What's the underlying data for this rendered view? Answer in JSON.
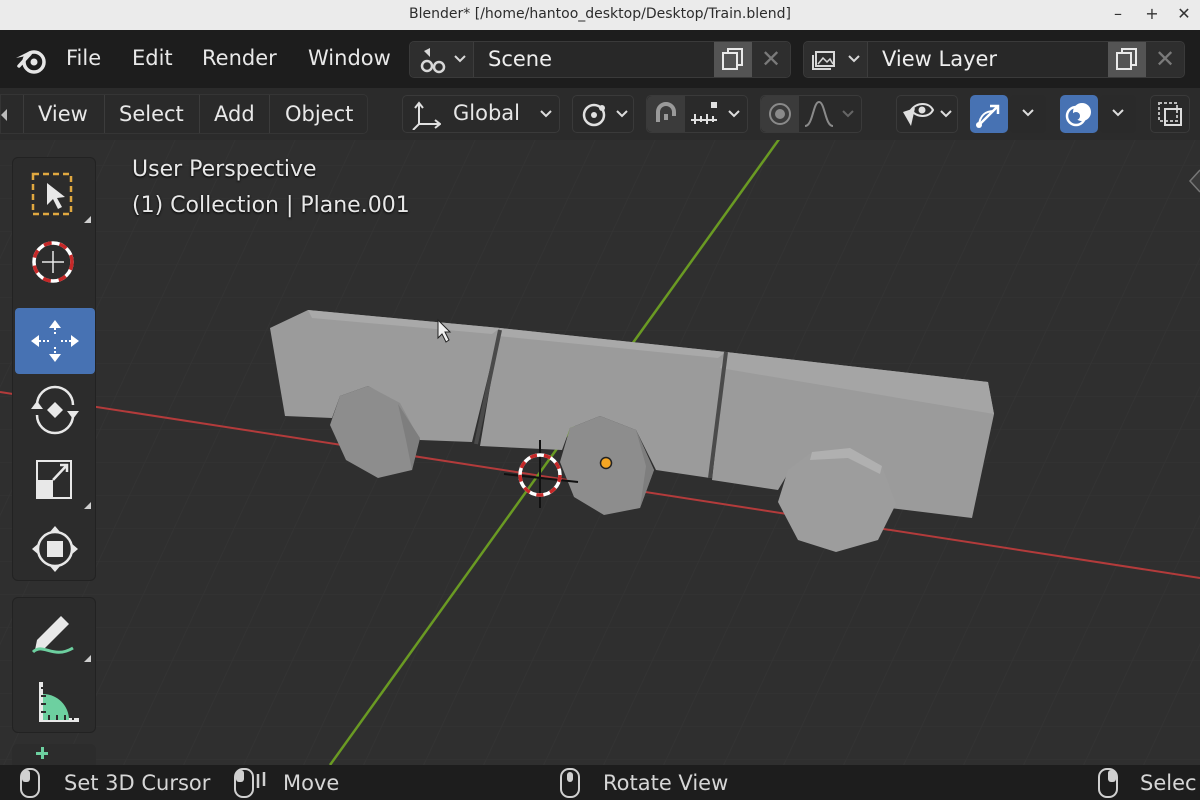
{
  "window": {
    "title": "Blender* [/home/hantoo_desktop/Desktop/Train.blend]",
    "minimize_glyph": "–",
    "maximize_glyph": "+",
    "close_glyph": "✕"
  },
  "menubar": {
    "items": [
      "File",
      "Edit",
      "Render",
      "Window"
    ],
    "scene_name": "Scene",
    "view_layer_name": "View Layer"
  },
  "viewport_header": {
    "menus": [
      "View",
      "Select",
      "Add",
      "Object"
    ],
    "transform_orientation": "Global"
  },
  "viewport": {
    "perspective_label": "User Perspective",
    "collection_label": "(1) Collection | Plane.001"
  },
  "toolbar": {
    "tools": [
      "select-box",
      "cursor",
      "move",
      "rotate",
      "scale",
      "transform",
      "annotate",
      "measure"
    ],
    "active_tool": "move"
  },
  "statusbar": {
    "items": [
      "Set 3D Cursor",
      "Move",
      "Rotate View",
      "Selec"
    ]
  },
  "colors": {
    "accent": "#4772b3",
    "x_axis": "#b33b3b",
    "y_axis": "#6a9a23",
    "mesh": "#9b9b9b",
    "origin": "#f5a623"
  }
}
